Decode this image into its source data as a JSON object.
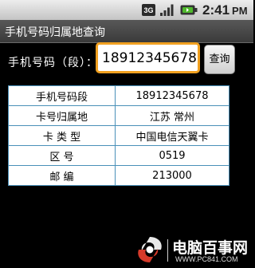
{
  "status_bar": {
    "network_label": "3G",
    "time": "2:41",
    "ampm": "PM"
  },
  "app": {
    "title": "手机号码归属地查询"
  },
  "query": {
    "label": "手机号码（段）：",
    "input_value": "18912345678",
    "button_label": "查询"
  },
  "results": [
    {
      "label": "手机号码段",
      "value": "18912345678"
    },
    {
      "label": "卡号归属地",
      "value": "江苏 常州"
    },
    {
      "label": "卡 类 型",
      "value": "中国电信天翼卡"
    },
    {
      "label": "区 号",
      "value": "0519"
    },
    {
      "label": "邮 编",
      "value": "213000"
    }
  ],
  "watermark": {
    "title": "电脑百事网",
    "url": "WWW.PC841.COM"
  }
}
